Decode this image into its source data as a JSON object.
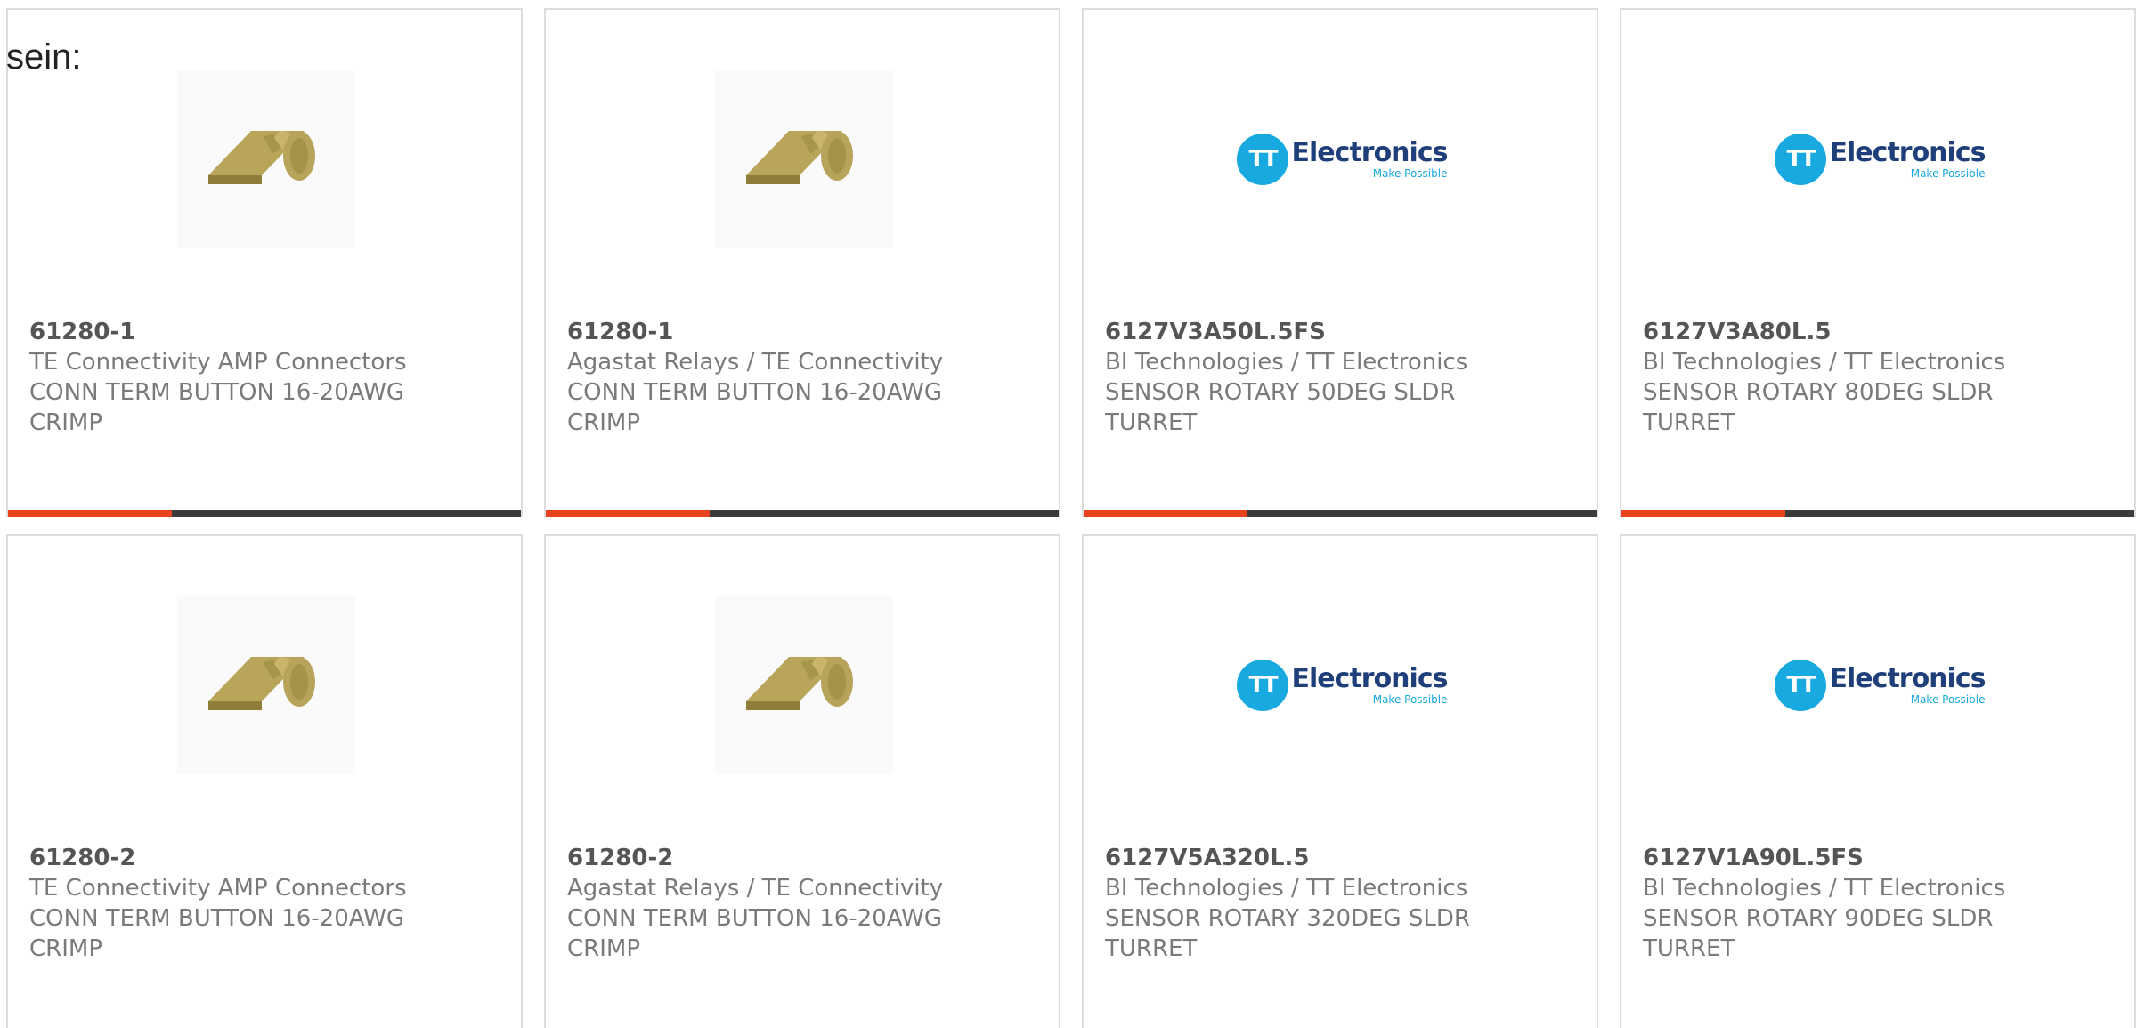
{
  "page": {
    "lead_text": "sein:"
  },
  "colors": {
    "accent": "#e8431f",
    "bar_track": "#3b3b3b",
    "logo_blue": "#19a9e1",
    "logo_navy": "#1f3f7a"
  },
  "logo": {
    "word": "Electronics",
    "tagline": "Make Possible",
    "mark": "TT"
  },
  "progress": {
    "fill_fraction": 0.32
  },
  "products": [
    {
      "part": "61280-1",
      "manufacturer": "TE Connectivity AMP Connectors",
      "desc1": "CONN TERM BUTTON 16-20AWG",
      "desc2": "CRIMP",
      "image": "crimp-terminal-photo"
    },
    {
      "part": "61280-1",
      "manufacturer": "Agastat Relays / TE Connectivity",
      "desc1": "CONN TERM BUTTON 16-20AWG",
      "desc2": "CRIMP",
      "image": "crimp-terminal-photo"
    },
    {
      "part": "6127V3A50L.5FS",
      "manufacturer": "BI Technologies / TT Electronics",
      "desc1": "SENSOR ROTARY 50DEG SLDR",
      "desc2": "TURRET",
      "image": "tt-electronics-logo"
    },
    {
      "part": "6127V3A80L.5",
      "manufacturer": "BI Technologies / TT Electronics",
      "desc1": "SENSOR ROTARY 80DEG SLDR",
      "desc2": "TURRET",
      "image": "tt-electronics-logo"
    },
    {
      "part": "61280-2",
      "manufacturer": "TE Connectivity AMP Connectors",
      "desc1": "CONN TERM BUTTON 16-20AWG",
      "desc2": "CRIMP",
      "image": "crimp-terminal-photo"
    },
    {
      "part": "61280-2",
      "manufacturer": "Agastat Relays / TE Connectivity",
      "desc1": "CONN TERM BUTTON 16-20AWG",
      "desc2": "CRIMP",
      "image": "crimp-terminal-photo"
    },
    {
      "part": "6127V5A320L.5",
      "manufacturer": "BI Technologies / TT Electronics",
      "desc1": "SENSOR ROTARY 320DEG SLDR",
      "desc2": "TURRET",
      "image": "tt-electronics-logo"
    },
    {
      "part": "6127V1A90L.5FS",
      "manufacturer": "BI Technologies / TT Electronics",
      "desc1": "SENSOR ROTARY 90DEG SLDR",
      "desc2": "TURRET",
      "image": "tt-electronics-logo"
    }
  ]
}
